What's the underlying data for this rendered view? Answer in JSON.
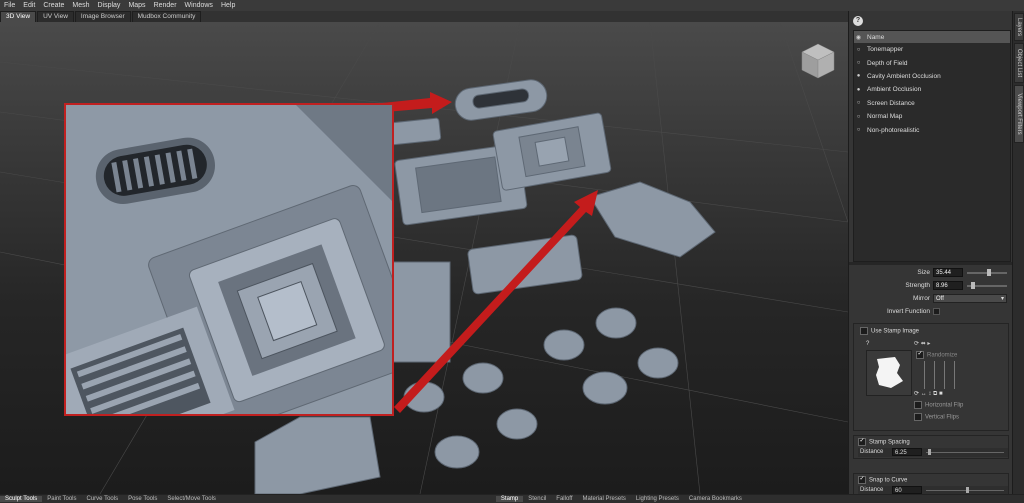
{
  "menu": [
    "File",
    "Edit",
    "Create",
    "Mesh",
    "Display",
    "Maps",
    "Render",
    "Windows",
    "Help"
  ],
  "tabs": [
    {
      "label": "3D View",
      "active": true
    },
    {
      "label": "UV View",
      "active": false
    },
    {
      "label": "Image Browser",
      "active": false
    },
    {
      "label": "Mudbox Community",
      "active": false
    }
  ],
  "side_tabs": [
    {
      "label": "Layers",
      "active": false
    },
    {
      "label": "Object List",
      "active": false
    },
    {
      "label": "Viewport Filters",
      "active": true
    }
  ],
  "viewport_filters": {
    "header": "Name",
    "items": [
      {
        "label": "Tonemapper",
        "enabled": false
      },
      {
        "label": "Depth of Field",
        "enabled": false
      },
      {
        "label": "Cavity Ambient Occlusion",
        "enabled": true
      },
      {
        "label": "Ambient Occlusion",
        "enabled": true
      },
      {
        "label": "Screen Distance",
        "enabled": false
      },
      {
        "label": "Normal Map",
        "enabled": false
      },
      {
        "label": "Non-photorealistic",
        "enabled": false
      }
    ]
  },
  "properties": {
    "size_label": "Size",
    "size_value": "35.44",
    "size_level": 0.55,
    "strength_label": "Strength",
    "strength_value": "8.96",
    "strength_level": 0.1,
    "mirror_label": "Mirror",
    "mirror_value": "Off",
    "invert_label": "Invert Function",
    "use_stamp_label": "Use Stamp Image",
    "randomize_label": "Randomize",
    "hflip_label": "Horizontal Flip",
    "vflip_label": "Vertical Flips",
    "stamp_spacing_label": "Stamp Spacing",
    "distance_label": "Distance",
    "distance_value": "6.25",
    "snap_label": "Snap to Curve",
    "distance2_label": "Distance",
    "distance2_value": "60"
  },
  "bottom_tabs": [
    {
      "label": "Sculpt Tools",
      "active": true
    },
    {
      "label": "Paint Tools",
      "active": false
    },
    {
      "label": "Curve Tools",
      "active": false
    },
    {
      "label": "Pose Tools",
      "active": false
    },
    {
      "label": "Select/Move Tools",
      "active": false
    },
    {
      "label": "Stamp",
      "active": true
    },
    {
      "label": "Stencil",
      "active": false
    },
    {
      "label": "Falloff",
      "active": false
    },
    {
      "label": "Material Presets",
      "active": false
    },
    {
      "label": "Lighting Presets",
      "active": false
    },
    {
      "label": "Camera Bookmarks",
      "active": false
    }
  ],
  "colors": {
    "accent": "#c02020",
    "panel": "#353535",
    "list_bg": "#2a2a2a",
    "header": "#555555",
    "model": "#8e99a6"
  }
}
